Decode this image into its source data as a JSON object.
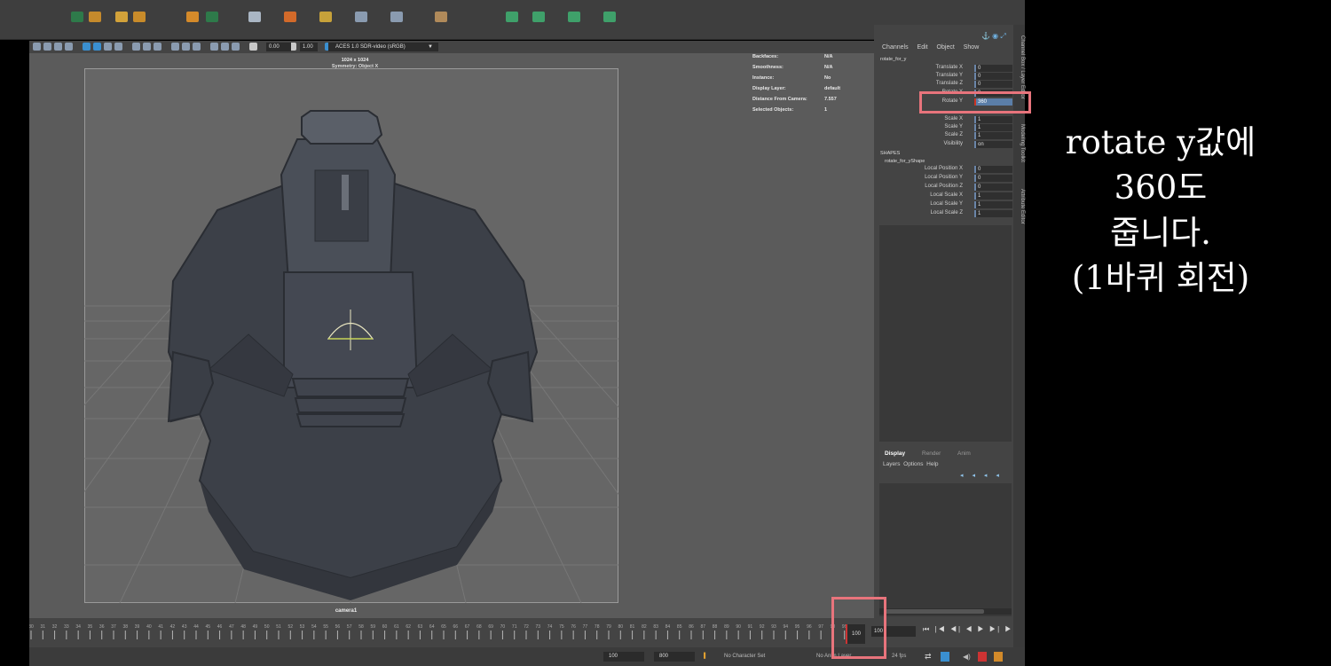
{
  "viewport": {
    "resolution_label": "1024 x 1024",
    "symmetry_label": "Symmetry: Object X",
    "camera_label": "camera1",
    "colorspace": "ACES 1.0 SDR-video (sRGB)",
    "exposure": "0.00",
    "gamma": "1.00",
    "hud": [
      {
        "label": "Backfaces:",
        "value": "N/A"
      },
      {
        "label": "Smoothness:",
        "value": "N/A"
      },
      {
        "label": "Instance:",
        "value": "No"
      },
      {
        "label": "Display Layer:",
        "value": "default"
      },
      {
        "label": "Distance From Camera:",
        "value": "7.557"
      },
      {
        "label": "Selected Objects:",
        "value": "1"
      }
    ]
  },
  "channel_box": {
    "menu": [
      "Channels",
      "Edit",
      "Object",
      "Show"
    ],
    "object_name": "rotate_for_y",
    "attributes": [
      {
        "label": "Translate X",
        "value": "0"
      },
      {
        "label": "Translate Y",
        "value": "0"
      },
      {
        "label": "Translate Z",
        "value": "0"
      },
      {
        "label": "Rotate X",
        "value": "0"
      },
      {
        "label": "Rotate Y",
        "value": "360"
      },
      {
        "label": "Scale X",
        "value": "1"
      },
      {
        "label": "Scale Y",
        "value": "1"
      },
      {
        "label": "Scale Z",
        "value": "1"
      },
      {
        "label": "Visibility",
        "value": "on"
      }
    ],
    "shapes_header": "SHAPES",
    "shape_name": "rotate_for_yShape",
    "shape_attributes": [
      {
        "label": "Local Position X",
        "value": "0"
      },
      {
        "label": "Local Position Y",
        "value": "0"
      },
      {
        "label": "Local Position Z",
        "value": "0"
      },
      {
        "label": "Local Scale X",
        "value": "1"
      },
      {
        "label": "Local Scale Y",
        "value": "1"
      },
      {
        "label": "Local Scale Z",
        "value": "1"
      }
    ]
  },
  "side_tabs": [
    "Channel Box / Layer Editor",
    "Modeling Toolkit",
    "Attribute Editor"
  ],
  "layer_editor": {
    "tabs": [
      "Display",
      "Render",
      "Anim"
    ],
    "menu": [
      "Layers",
      "Options",
      "Help"
    ]
  },
  "timeline": {
    "tick_start": 30,
    "tick_end": 100,
    "current_frame": "100",
    "frame_field": "100",
    "playback_controls": "⏮ |◀ ◀| ◀ ▶ ▶| ▶▶|",
    "range_start": "100",
    "range_end": "800",
    "character_set": "No Character Set",
    "anim_layer": "No Anim Layer",
    "fps": "24 fps"
  },
  "annotation": {
    "line1": "rotate y값에",
    "line2": "360도",
    "line3": "줍니다.",
    "line4": "(1바퀴 회전)"
  },
  "colors": {
    "highlight": "#e8747c",
    "selected_field": "#5b7ea8",
    "model": "#3c4048"
  }
}
